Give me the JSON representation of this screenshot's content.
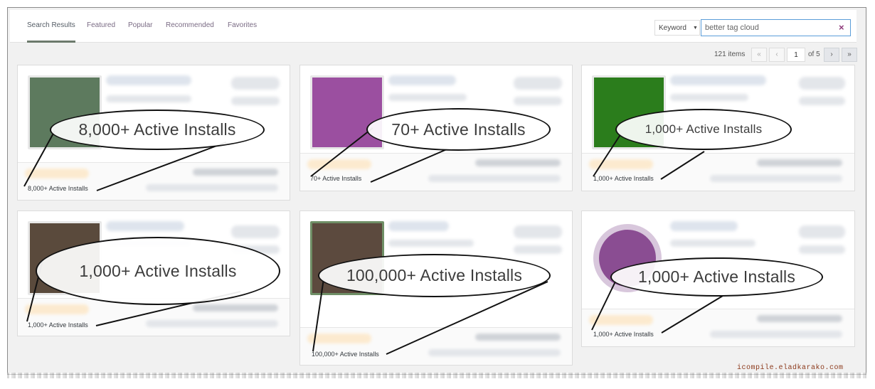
{
  "tabs": [
    {
      "label": "Search Results",
      "active": true
    },
    {
      "label": "Featured",
      "active": false
    },
    {
      "label": "Popular",
      "active": false
    },
    {
      "label": "Recommended",
      "active": false
    },
    {
      "label": "Favorites",
      "active": false
    }
  ],
  "search": {
    "type_label": "Keyword",
    "query": "better tag cloud",
    "clear_glyph": "×"
  },
  "pagination": {
    "items_label": "121 items",
    "first": "«",
    "prev": "‹",
    "current_page": "1",
    "of_label": "of 5",
    "next": "›",
    "last": "»"
  },
  "cards": [
    {
      "installs": "8,000+ Active Installs",
      "callout": "8,000+ Active Installs",
      "thumb_color": "#5d7a5e"
    },
    {
      "installs": "70+ Active Installs",
      "callout": "70+ Active Installs",
      "thumb_color": "#9b4fa0"
    },
    {
      "installs": "1,000+ Active Installs",
      "callout": "1,000+ Active Installs",
      "thumb_color": "#2b7d1c"
    },
    {
      "installs": "1,000+ Active Installs",
      "callout": "1,000+ Active Installs",
      "thumb_color": "#5a4a3c"
    },
    {
      "installs": "100,000+ Active Installs",
      "callout": "100,000+ Active Installs",
      "thumb_color": "#5c4a3e"
    },
    {
      "installs": "1,000+ Active Installs",
      "callout": "1,000+ Active Installs",
      "thumb_color": "#8a4d92"
    }
  ],
  "watermark": "icompile.eladkarako.com",
  "colors": {
    "accent": "#8e3a7a",
    "active_tab_underline": "#6c7a6c",
    "callout_stroke": "#111111",
    "star_blur": "#fde8c8"
  }
}
